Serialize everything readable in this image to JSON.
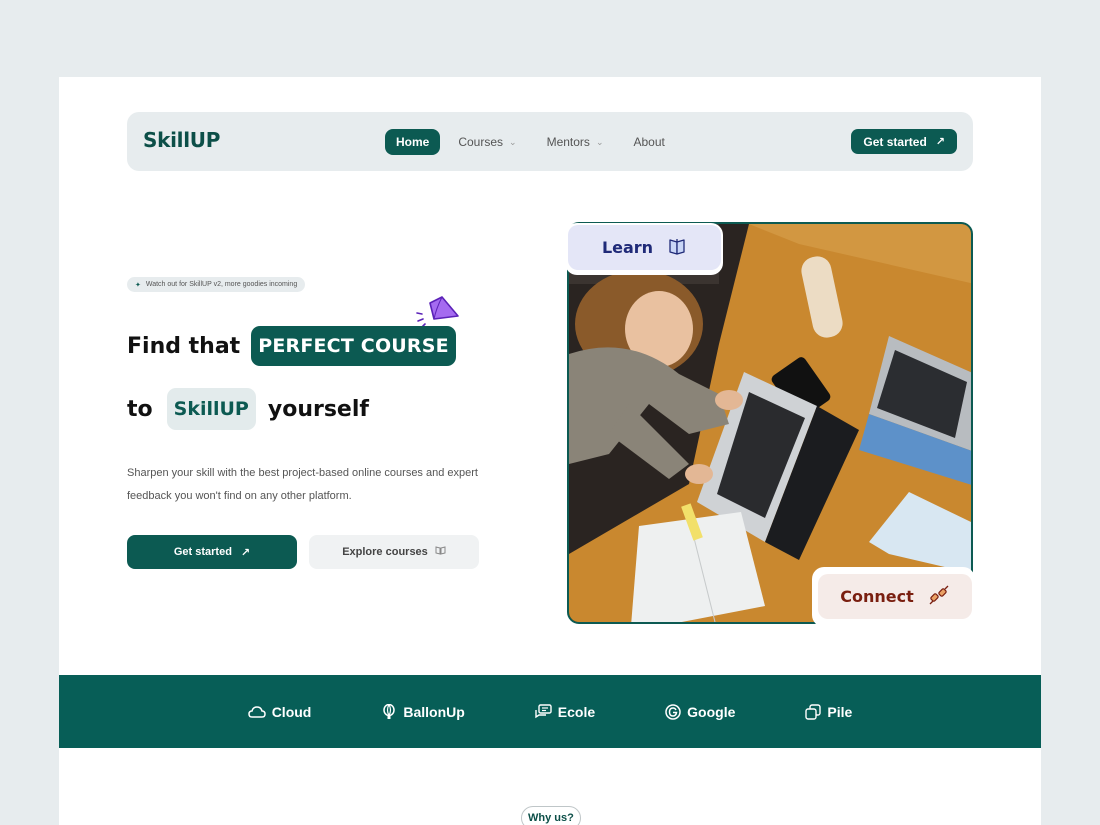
{
  "nav": {
    "logo": "SkillUP",
    "links": [
      {
        "label": "Home",
        "active": true
      },
      {
        "label": "Courses",
        "dropdown": true
      },
      {
        "label": "Mentors",
        "dropdown": true
      },
      {
        "label": "About"
      }
    ],
    "cta": "Get started"
  },
  "hero": {
    "badge": "Watch out for SkillUP v2, more goodies incoming",
    "line1_text": "Find that",
    "line1_highlight": "PERFECT COURSE",
    "line2_prefix": "to",
    "line2_highlight": "SkillUP",
    "line2_suffix": "yourself",
    "description": "Sharpen your skill with the best project-based online courses and expert feedback you won't find on any other platform.",
    "primary_button": "Get started",
    "secondary_button": "Explore courses",
    "learn_chip": "Learn",
    "connect_chip": "Connect"
  },
  "partners": [
    {
      "name": "Cloud",
      "icon": "cloud-icon"
    },
    {
      "name": "BallonUp",
      "icon": "balloon-icon"
    },
    {
      "name": "Ecole",
      "icon": "chat-icon"
    },
    {
      "name": "Google",
      "icon": "google-icon"
    },
    {
      "name": "Pile",
      "icon": "copy-icon"
    }
  ],
  "section": {
    "why_label": "Why us?"
  },
  "colors": {
    "brand": "#0c5a52",
    "band": "#075e57",
    "learn_bg": "#e4e6f7",
    "learn_text": "#1f2a78",
    "connect_bg": "#f5ebe8",
    "connect_text": "#7a1f10",
    "accent_star": "#a56bf0"
  }
}
